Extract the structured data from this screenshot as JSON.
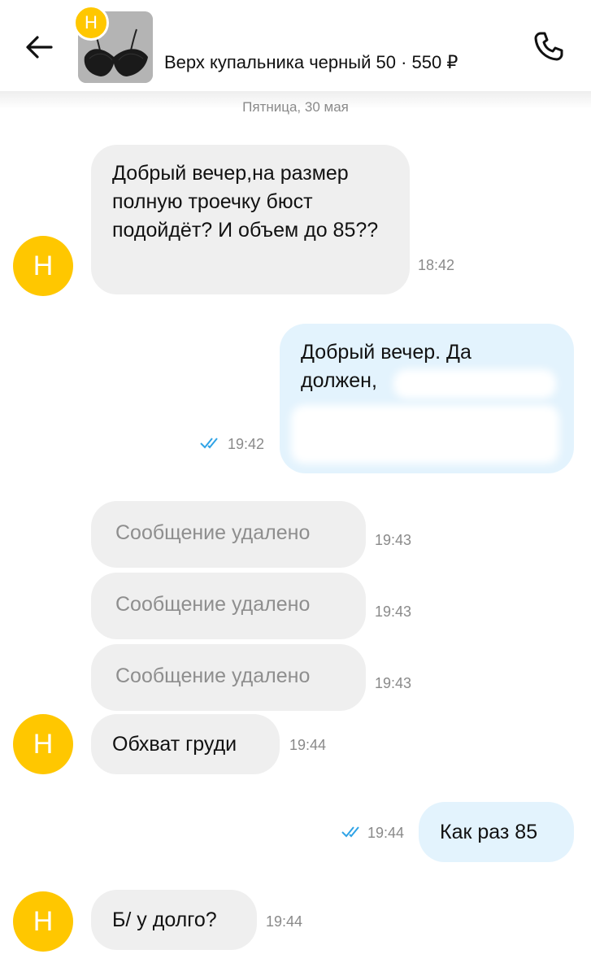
{
  "header": {
    "avatar_initial": "Н",
    "title": "Верх купальника черный 50 · 550 ₽",
    "icons": {
      "back": "arrow-left-icon",
      "call": "phone-icon"
    }
  },
  "date_separator": "Пятница, 30 мая",
  "avatar_initial": "Н",
  "messages": [
    {
      "side": "in",
      "text": "Добрый вечер,на размер полную троечку бюст подойдёт? И объем до 85??",
      "time": "18:42"
    },
    {
      "side": "out",
      "text": "Добрый вечер. Да должен,",
      "time": "19:42",
      "read": true
    },
    {
      "side": "in",
      "text": "Сообщение удалено",
      "time": "19:43",
      "deleted": true
    },
    {
      "side": "in",
      "text": "Сообщение удалено",
      "time": "19:43",
      "deleted": true
    },
    {
      "side": "in",
      "text": "Сообщение удалено",
      "time": "19:43",
      "deleted": true
    },
    {
      "side": "in",
      "text": "Обхват груди",
      "time": "19:44"
    },
    {
      "side": "out",
      "text": "Как раз 85",
      "time": "19:44",
      "read": true
    },
    {
      "side": "in",
      "text": "Б/ у долго?",
      "time": "19:44"
    }
  ],
  "colors": {
    "avatar": "#FFC700",
    "incoming_bubble": "#efefef",
    "outgoing_bubble": "#e3f3fd",
    "read_ticks": "#2fa3e6"
  }
}
